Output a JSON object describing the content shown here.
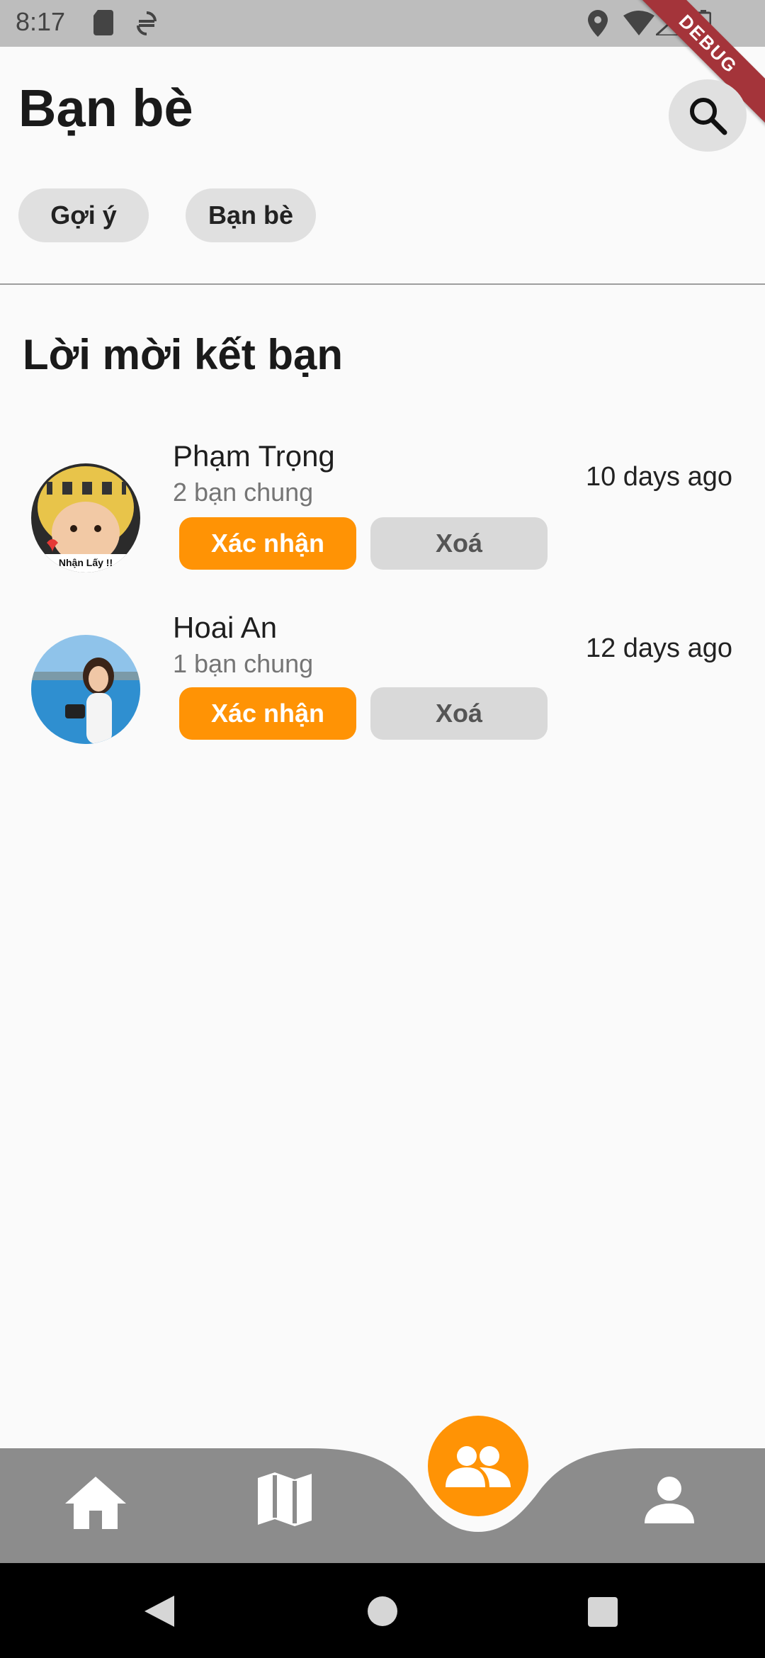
{
  "status_bar": {
    "time": "8:17",
    "debug_label": "DEBUG",
    "icons": [
      "sd-card-icon",
      "sync-icon",
      "location-icon",
      "wifi-icon",
      "signal-icon",
      "battery-icon"
    ]
  },
  "header": {
    "title": "Bạn bè",
    "search_icon": "search-icon"
  },
  "chips": [
    {
      "label": "Gợi ý"
    },
    {
      "label": "Bạn bè"
    }
  ],
  "section": {
    "title": "Lời mời kết bạn"
  },
  "requests": [
    {
      "name": "Phạm Trọng",
      "mutual": "2 bạn chung",
      "time": "10 days ago",
      "avatar_caption": "Nhận Lấy !!",
      "confirm_label": "Xác nhận",
      "delete_label": "Xoá"
    },
    {
      "name": "Hoai An",
      "mutual": "1 bạn chung",
      "time": "12 days ago",
      "confirm_label": "Xác nhận",
      "delete_label": "Xoá"
    }
  ],
  "bottom_nav": {
    "items": [
      "home-icon",
      "map-icon",
      "friends-icon",
      "person-icon"
    ],
    "active": "friends-icon",
    "bar_color": "#8c8c8c",
    "accent_color": "#ff9305"
  },
  "system_nav": [
    "back-icon",
    "home-circle-icon",
    "recents-icon"
  ]
}
